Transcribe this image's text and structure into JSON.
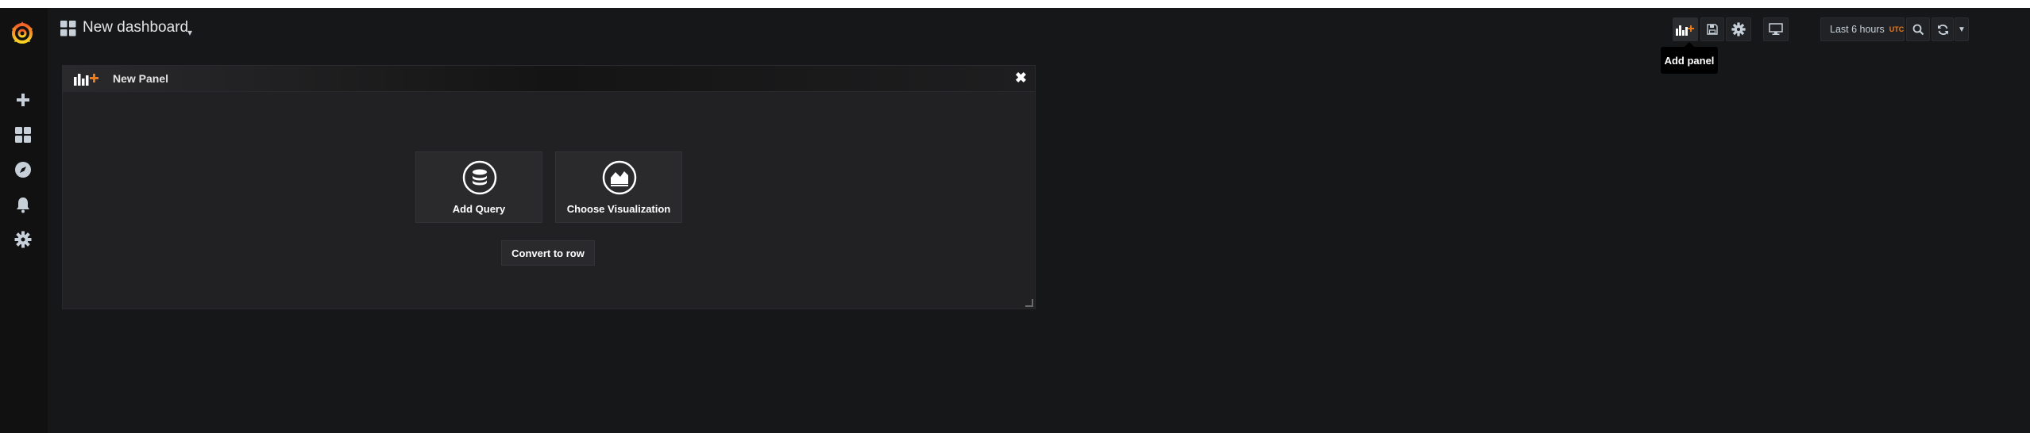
{
  "app": {
    "title": "New dashboard"
  },
  "sidebar": {
    "logo": "grafana-logo",
    "items": [
      {
        "name": "create",
        "icon": "plus-icon"
      },
      {
        "name": "dashboards",
        "icon": "dashboards-grid-icon"
      },
      {
        "name": "explore",
        "icon": "compass-icon"
      },
      {
        "name": "alerting",
        "icon": "bell-icon"
      },
      {
        "name": "configuration",
        "icon": "gear-icon"
      }
    ]
  },
  "toolbar": {
    "add_panel_icon": "add-panel-icon",
    "save_icon": "save-icon",
    "settings_icon": "cog-icon",
    "cycle_view_icon": "monitor-icon",
    "time_range": "Last 6 hours",
    "timezone": "UTC",
    "zoom_icon": "magnifier-icon",
    "refresh_icon": "refresh-icon",
    "tooltip": "Add panel"
  },
  "panel": {
    "title": "New Panel",
    "close_icon": "close-icon",
    "add_query_label": "Add Query",
    "choose_viz_label": "Choose Visualization",
    "convert_label": "Convert to row"
  },
  "colors": {
    "accent": "#eb7b18",
    "background": "#161719",
    "sidebar": "#111111",
    "panel": "#212124"
  }
}
